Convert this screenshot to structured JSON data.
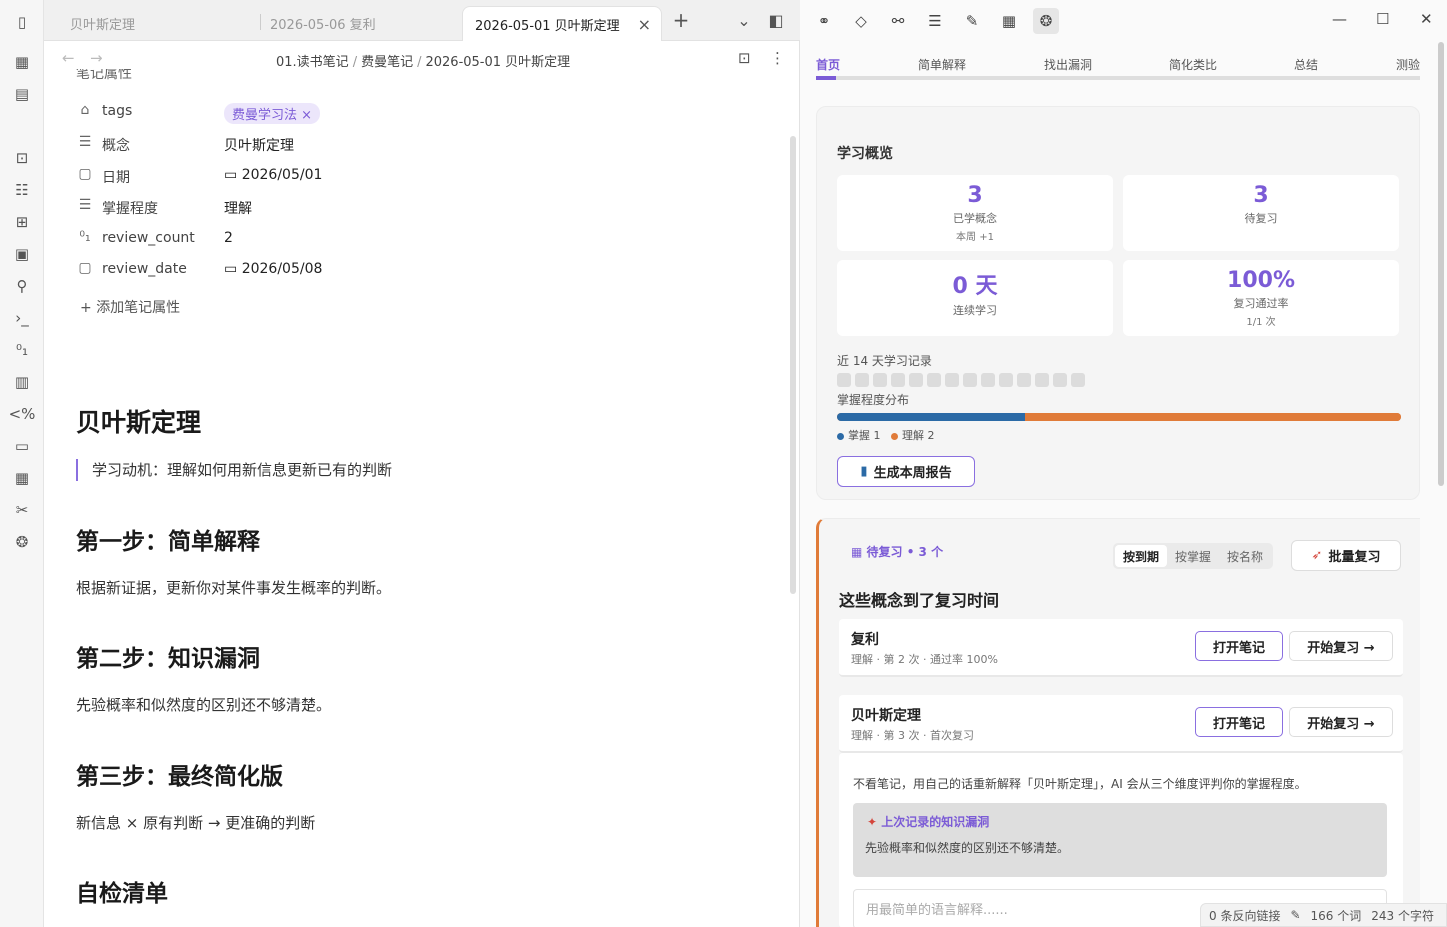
{
  "tabs": [
    {
      "label": "贝叶斯定理",
      "active": false
    },
    {
      "label": "2026-05-06 复利",
      "active": false
    },
    {
      "label": "2026-05-01 贝叶斯定理",
      "active": true
    }
  ],
  "breadcrumb": [
    "01.读书笔记",
    "费曼笔记",
    "2026-05-01 贝叶斯定理"
  ],
  "properties_header": "笔记属性",
  "properties": [
    {
      "icon": "tag-icon",
      "key": "tags",
      "value": "费曼学习法",
      "type": "tag"
    },
    {
      "icon": "list-icon",
      "key": "概念",
      "value": "贝叶斯定理",
      "type": "text"
    },
    {
      "icon": "calendar-icon",
      "key": "日期",
      "value": "2026/05/01",
      "type": "date"
    },
    {
      "icon": "list-icon",
      "key": "掌握程度",
      "value": "理解",
      "type": "text"
    },
    {
      "icon": "number-icon",
      "key": "review_count",
      "value": "2",
      "type": "number"
    },
    {
      "icon": "calendar-icon",
      "key": "review_date",
      "value": "2026/05/08",
      "type": "date"
    }
  ],
  "add_property": "添加笔记属性",
  "note": {
    "title": "贝叶斯定理",
    "motivation": "学习动机：理解如何用新信息更新已有的判断",
    "step1_title": "第一步：简单解释",
    "step1_text": "根据新证据，更新你对某件事发生概率的判断。",
    "step2_title": "第二步：知识漏洞",
    "step2_text": "先验概率和似然度的区别还不够清楚。",
    "step3_title": "第三步：最终简化版",
    "step3_text": "新信息 × 原有判断 → 更准确的判断",
    "checklist_title": "自检清单"
  },
  "right_tabs": [
    "首页",
    "简单解释",
    "找出漏洞",
    "简化类比",
    "总结",
    "测验"
  ],
  "overview": {
    "title": "学习概览",
    "stats": [
      {
        "num": "3",
        "label": "已学概念",
        "sub": "本周 +1"
      },
      {
        "num": "3",
        "label": "待复习",
        "sub": ""
      },
      {
        "num": "0 天",
        "label": "连续学习",
        "sub": ""
      },
      {
        "num": "100%",
        "label": "复习通过率",
        "sub": "1/1 次"
      }
    ],
    "record_title": "近 14 天学习记录",
    "record_days": 14,
    "dist_title": "掌握程度分布",
    "dist": [
      {
        "label": "掌握 1",
        "count": 1,
        "color": "#2b6aa6"
      },
      {
        "label": "理解 2",
        "count": 2,
        "color": "#e07b39"
      }
    ],
    "report_btn": "生成本周报告"
  },
  "review": {
    "header": "待复习 • 3 个",
    "sort_options": [
      "按到期",
      "按掌握",
      "按名称"
    ],
    "sort_active": 0,
    "batch_btn": "批量复习",
    "title": "这些概念到了复习时间",
    "items": [
      {
        "name": "复利",
        "meta": "理解 · 第 2 次 · 通过率 100%"
      },
      {
        "name": "贝叶斯定理",
        "meta": "理解 · 第 3 次 · 首次复习"
      }
    ],
    "open_btn": "打开笔记",
    "start_btn": "开始复习 →",
    "prompt": "不看笔记，用自己的话重新解释「贝叶斯定理」，AI 会从三个维度评判你的掌握程度。",
    "gap_title": "上次记录的知识漏洞",
    "gap_text": "先验概率和似然度的区别还不够清楚。",
    "answer_placeholder": "用最简单的语言解释......"
  },
  "status": {
    "backlinks": "0 条反向链接",
    "words": "166 个词",
    "chars": "243 个字符"
  },
  "colors": {
    "accent": "#7b5bd6",
    "orange": "#e07b39",
    "blue": "#2b6aa6"
  }
}
